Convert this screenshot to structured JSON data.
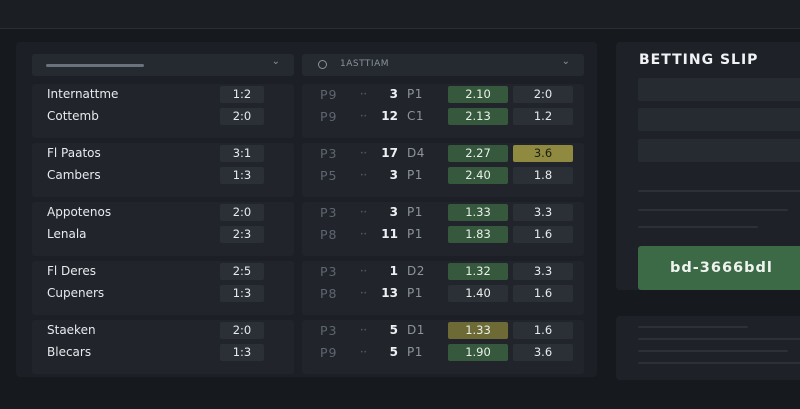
{
  "left_header": {},
  "right_header": {
    "label": "1ASTTIAM"
  },
  "matches": [
    {
      "home": "Internattme",
      "home_score": "1:2",
      "away": "Cottemb",
      "away_score": "2:0",
      "rows": [
        {
          "period": "P9",
          "mins": "3",
          "code": "P1",
          "odd1": "2.10",
          "odd2": "2:0",
          "odd1_state": "green",
          "odd2_state": "plain"
        },
        {
          "period": "P9",
          "mins": "12",
          "code": "C1",
          "odd1": "2.13",
          "odd2": "1.2",
          "odd1_state": "green",
          "odd2_state": "plain"
        }
      ]
    },
    {
      "home": "Fl Paatos",
      "home_score": "3:1",
      "away": "Cambers",
      "away_score": "1:3",
      "rows": [
        {
          "period": "P3",
          "mins": "17",
          "code": "D4",
          "odd1": "2.27",
          "odd2": "3.6",
          "odd1_state": "green",
          "odd2_state": "selected"
        },
        {
          "period": "P5",
          "mins": "3",
          "code": "P1",
          "odd1": "2.40",
          "odd2": "1.8",
          "odd1_state": "green",
          "odd2_state": "plain"
        }
      ]
    },
    {
      "home": "Appotenos",
      "home_score": "2:0",
      "away": "Lenala",
      "away_score": "2:3",
      "rows": [
        {
          "period": "P3",
          "mins": "3",
          "code": "P1",
          "odd1": "1.33",
          "odd2": "3.3",
          "odd1_state": "green",
          "odd2_state": "plain"
        },
        {
          "period": "P8",
          "mins": "11",
          "code": "P1",
          "odd1": "1.83",
          "odd2": "1.6",
          "odd1_state": "green",
          "odd2_state": "plain"
        }
      ]
    },
    {
      "home": "Fl Deres",
      "home_score": "2:5",
      "away": "Cupeners",
      "away_score": "1:3",
      "rows": [
        {
          "period": "P3",
          "mins": "1",
          "code": "D2",
          "odd1": "1.32",
          "odd2": "3.3",
          "odd1_state": "green",
          "odd2_state": "plain"
        },
        {
          "period": "P8",
          "mins": "13",
          "code": "P1",
          "odd1": "1.40",
          "odd2": "1.6",
          "odd1_state": "plain",
          "odd2_state": "plain"
        }
      ]
    },
    {
      "home": "Staeken",
      "home_score": "2:0",
      "away": "Blecars",
      "away_score": "1:3",
      "rows": [
        {
          "period": "P3",
          "mins": "5",
          "code": "D1",
          "odd1": "1.33",
          "odd2": "1.6",
          "odd1_state": "selected",
          "odd2_state": "plain"
        },
        {
          "period": "P9",
          "mins": "5",
          "code": "P1",
          "odd1": "1.90",
          "odd2": "3.6",
          "odd1_state": "green",
          "odd2_state": "plain"
        }
      ]
    }
  ],
  "slip": {
    "title": "BETTING SLIP",
    "code": "bd-3666bdl"
  },
  "colors": {
    "odd_green": "#36583d",
    "odd_selected": "#8f8a3f",
    "slip_button": "#3d6a46"
  },
  "icons": {
    "dropdown": "chevron-down-icon",
    "sort": "circle-icon"
  }
}
